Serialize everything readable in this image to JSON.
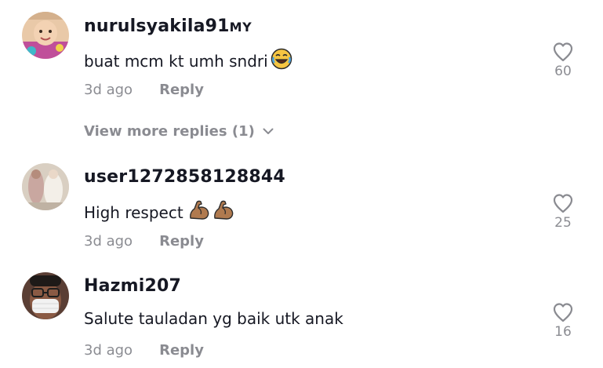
{
  "comments": [
    {
      "username": "nurulsyakila91",
      "username_suffix": "MY",
      "text": "buat mcm kt umh sndri",
      "emoji": "face-with-tears-of-joy",
      "time": "3d ago",
      "reply_label": "Reply",
      "likes": "60"
    },
    {
      "username": "user1272858128844",
      "text": "High respect",
      "emoji": "flexed-biceps-x2",
      "time": "3d ago",
      "reply_label": "Reply",
      "likes": "25"
    },
    {
      "username": "Hazmi207",
      "text": "Salute tauladan yg baik utk anak",
      "time": "3d ago",
      "reply_label": "Reply",
      "likes": "16"
    }
  ],
  "view_more_replies": "View more replies (1)",
  "colors": {
    "text_primary": "#161823",
    "text_secondary": "rgba(22,24,35,0.5)",
    "background": "#ffffff"
  }
}
